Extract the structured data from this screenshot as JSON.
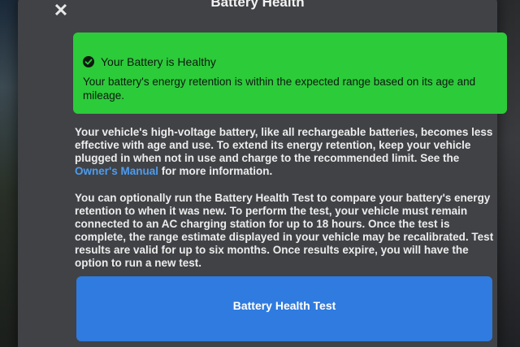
{
  "dialog": {
    "title": "Battery Health",
    "close_icon": "close-icon"
  },
  "status": {
    "icon": "check-circle-icon",
    "color": "#2ccb3a",
    "title": "Your Battery is Healthy",
    "description": "Your battery's energy retention is within the expected range based on its age and mileage."
  },
  "info": {
    "paragraph1_before_link": "Your vehicle's high-voltage battery, like all rechargeable batteries, becomes less effective with age and use. To extend its energy retention, keep your vehicle plugged in when not in use and charge to the recommended limit. See the ",
    "paragraph1_link": "Owner's Manual",
    "paragraph1_after_link": " for more information.",
    "paragraph2": "You can optionally run the Battery Health Test to compare your battery's energy retention to when it was new. To perform the test, your vehicle must remain connected to an AC charging station for up to 18 hours. Once the test is complete, the range estimate displayed in your vehicle may be recalibrated. Test results are valid for up to six months. Once results expire, you will have the option to run a new test."
  },
  "actions": {
    "test_button_label": "Battery Health Test",
    "accent_color": "#2f7be0",
    "link_color": "#4d9cf0"
  }
}
